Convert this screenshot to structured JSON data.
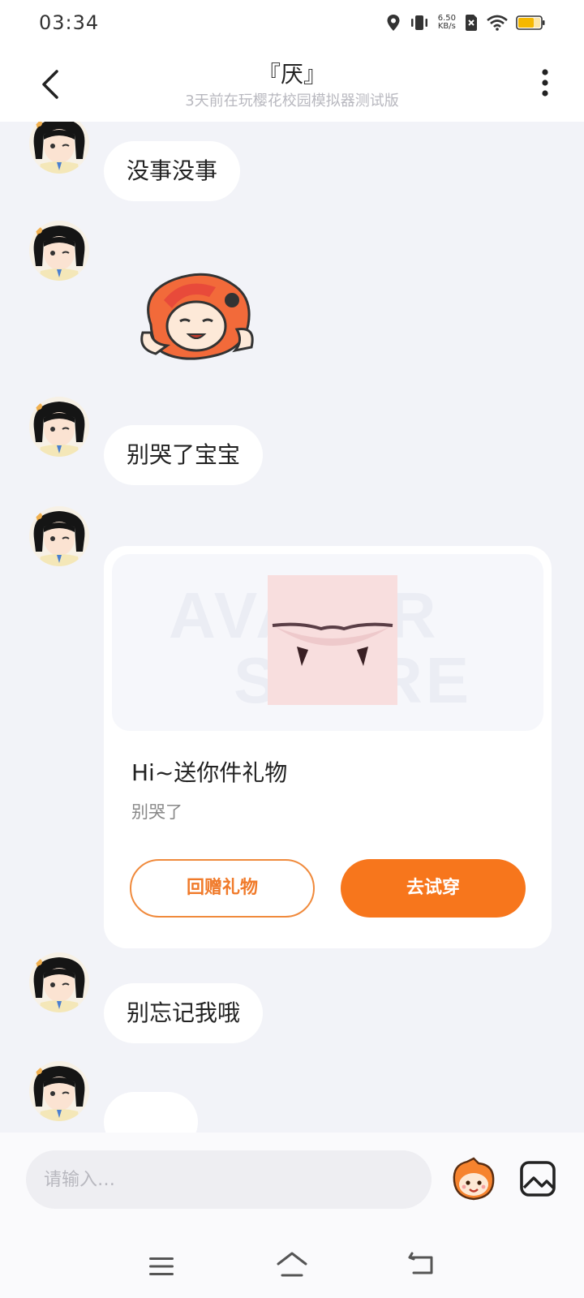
{
  "status_bar": {
    "time": "03:34",
    "net_speed_value": "6.50",
    "net_speed_unit": "KB/s",
    "icons": [
      "location-icon",
      "vibrate-icon",
      "no-sim-icon",
      "wifi-icon",
      "battery-icon"
    ]
  },
  "header": {
    "title": "『厌』",
    "subtitle": "3天前在玩樱花校园模拟器测试版"
  },
  "messages": [
    {
      "type": "text",
      "text": "没事没事"
    },
    {
      "type": "sticker",
      "icon": "sticker-character-icon"
    },
    {
      "type": "text",
      "text": "别哭了宝宝"
    },
    {
      "type": "gift"
    },
    {
      "type": "text",
      "text": "别忘记我哦"
    }
  ],
  "gift_card": {
    "watermark_line1": "AVATAR",
    "watermark_line2": "STORE",
    "item_icon": "fang-mouth-icon",
    "title": "Hi~送你件礼物",
    "message": "别哭了",
    "return_gift_label": "回赠礼物",
    "try_on_label": "去试穿"
  },
  "input_bar": {
    "placeholder": "请输入…",
    "emoji_icon": "mascot-emoji-icon",
    "image_icon": "image-icon"
  },
  "colors": {
    "accent": "#f7761c",
    "background": "#f2f3f8",
    "bubble": "#ffffff"
  }
}
